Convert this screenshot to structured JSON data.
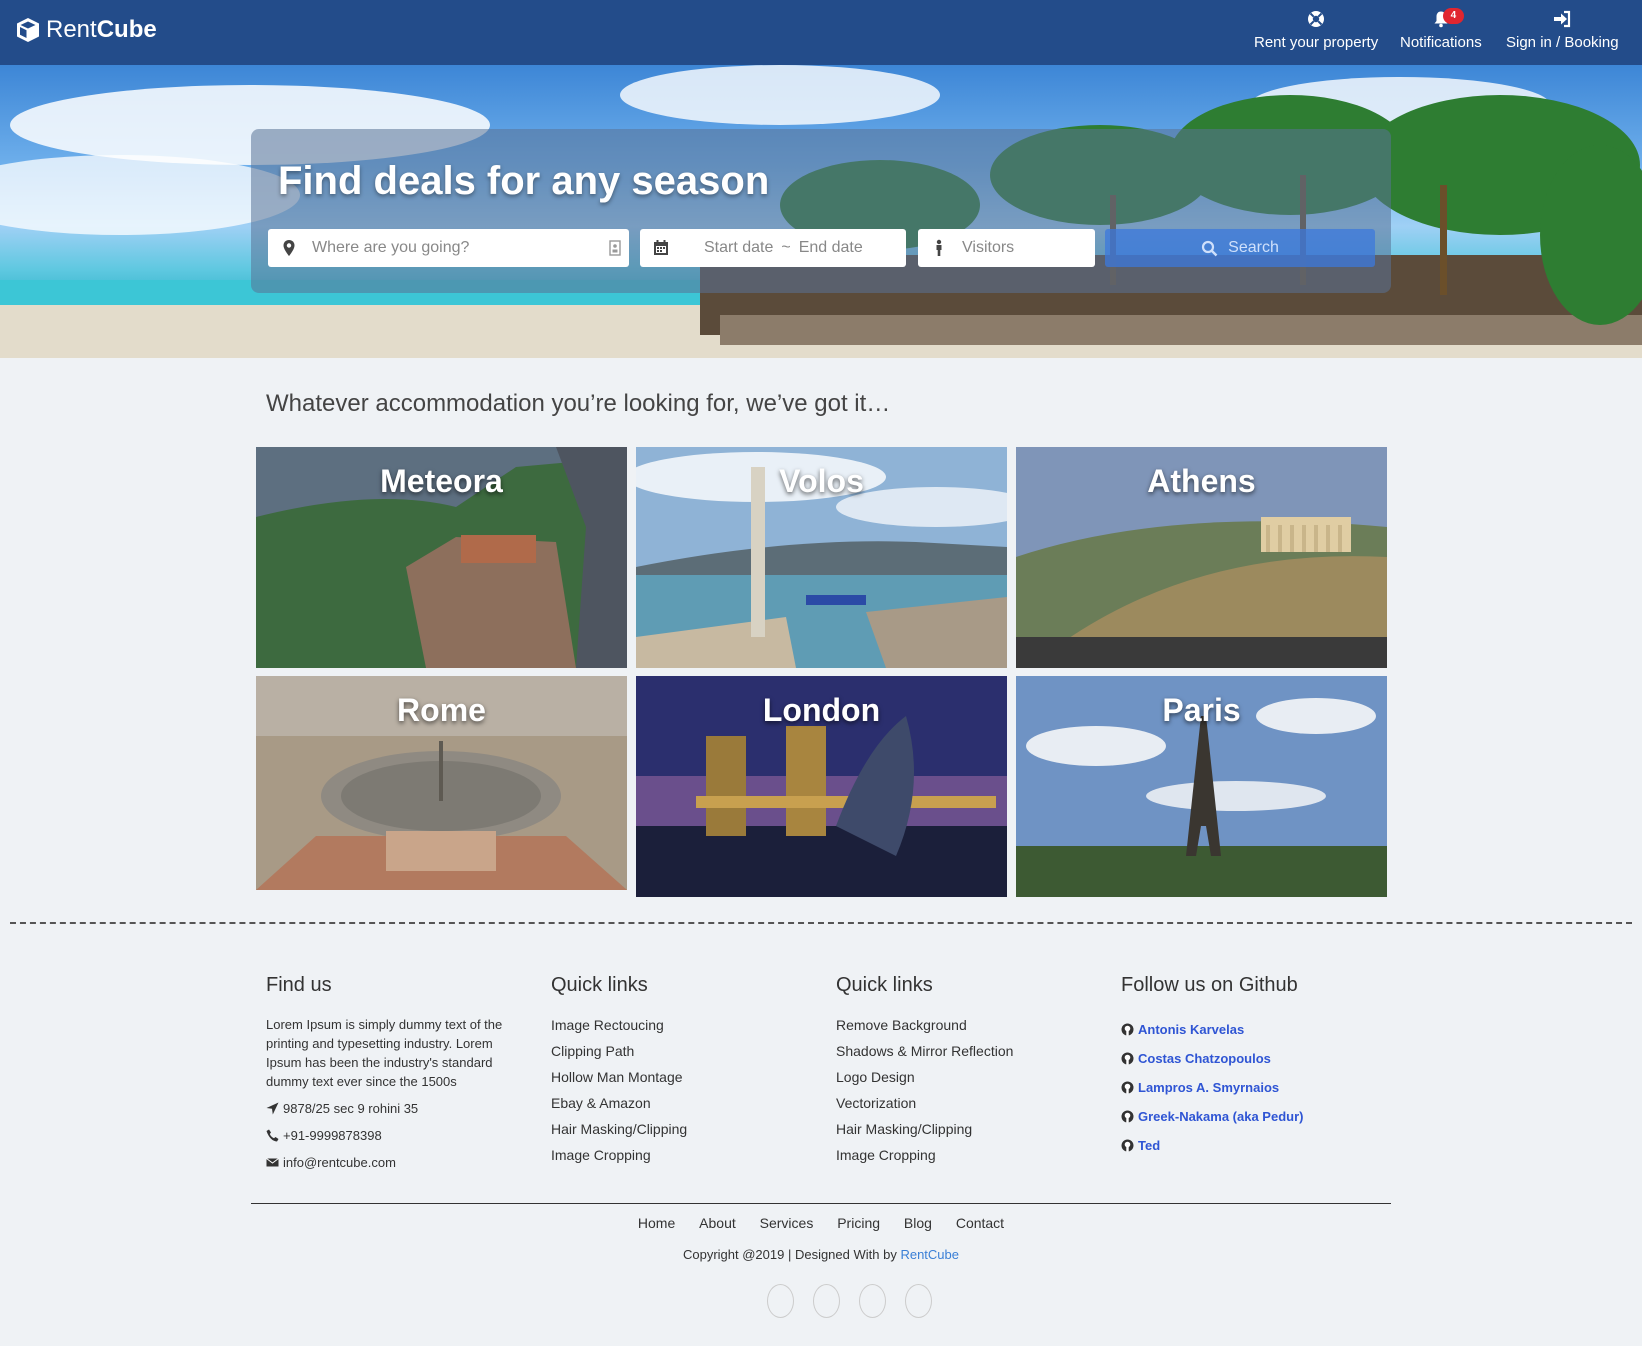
{
  "nav": {
    "brand_regular": "Rent",
    "brand_bold": "Cube",
    "items": [
      {
        "label": "Rent your property",
        "icon": "lifebuoy-icon"
      },
      {
        "label": "Notifications",
        "icon": "bell-icon",
        "badge": "4"
      },
      {
        "label": "Sign in / Booking",
        "icon": "sign-in-icon"
      }
    ]
  },
  "hero": {
    "title": "Find deals for any season",
    "where_placeholder": "Where are you going?",
    "start_placeholder": "Start date",
    "date_separator": "~",
    "end_placeholder": "End date",
    "visitors_placeholder": "Visitors",
    "search_label": "Search"
  },
  "main": {
    "tagline": "Whatever accommodation you’re looking for, we’ve got it…",
    "destinations": [
      "Meteora",
      "Volos",
      "Athens",
      "Rome",
      "London",
      "Paris"
    ]
  },
  "footer": {
    "find_us": {
      "heading": "Find us",
      "text": "Lorem Ipsum is simply dummy text of the printing and typesetting industry. Lorem Ipsum has been the industry's standard dummy text ever since the 1500s",
      "address": "9878/25 sec 9 rohini 35",
      "phone": "+91-9999878398",
      "email": "info@rentcube.com"
    },
    "quick_links_1": {
      "heading": "Quick links",
      "items": [
        "Image Rectoucing",
        "Clipping Path",
        "Hollow Man Montage",
        "Ebay & Amazon",
        "Hair Masking/Clipping",
        "Image Cropping"
      ]
    },
    "quick_links_2": {
      "heading": "Quick links",
      "items": [
        "Remove Background",
        "Shadows & Mirror Reflection",
        "Logo Design",
        "Vectorization",
        "Hair Masking/Clipping",
        "Image Cropping"
      ]
    },
    "github": {
      "heading": "Follow us on Github",
      "items": [
        "Antonis Karvelas",
        "Costas Chatzopoulos",
        "Lampros A. Smyrnaios",
        "Greek-Nakama (aka Pedur)",
        "Ted"
      ]
    },
    "nav": [
      "Home",
      "About",
      "Services",
      "Pricing",
      "Blog",
      "Contact"
    ],
    "copyright_text": "Copyright @2019 | Designed With by ",
    "copyright_brand": "RentCube"
  },
  "colors": {
    "navbar": "#234c8a",
    "badge": "#e0262f",
    "link": "#2f55d4",
    "page_bg": "#eff2f5"
  }
}
